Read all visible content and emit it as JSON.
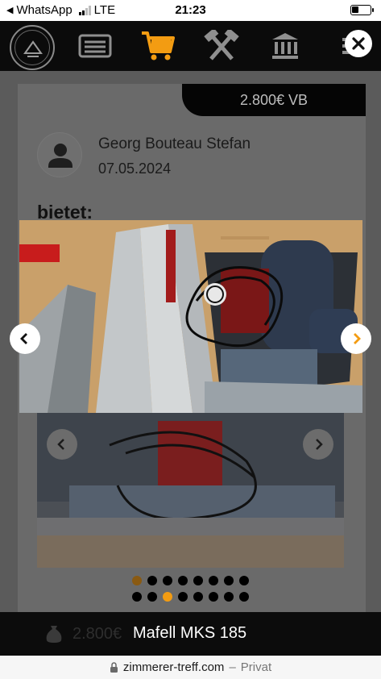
{
  "status_bar": {
    "back_app": "WhatsApp",
    "network": "LTE",
    "time": "21:23",
    "battery_level": 0.4
  },
  "nav": {
    "icons": [
      "logo-icon",
      "list-icon",
      "cart-icon",
      "hammers-icon",
      "bank-icon",
      "menu-icon"
    ],
    "active_icon": "cart-icon",
    "accent_color": "#f39c12"
  },
  "listing": {
    "price_tag": "2.800€ VB",
    "seller_name": "Georg Bouteau Stefan",
    "date": "07.05.2024",
    "heading_partial": "bietet:"
  },
  "carousel": {
    "main_dot_count": 8,
    "main_active_index": 0,
    "modal_dot_count": 8,
    "modal_active_index": 2
  },
  "bottom_bar": {
    "price": "2.800€",
    "title": "Mafell MKS 185"
  },
  "browser": {
    "domain": "zimmerer-treff.com",
    "separator": "–",
    "suffix": "Privat"
  },
  "colors": {
    "accent": "#f39c12",
    "nav_bg": "#0b0b0b",
    "overlay": "#5b5b5b"
  }
}
